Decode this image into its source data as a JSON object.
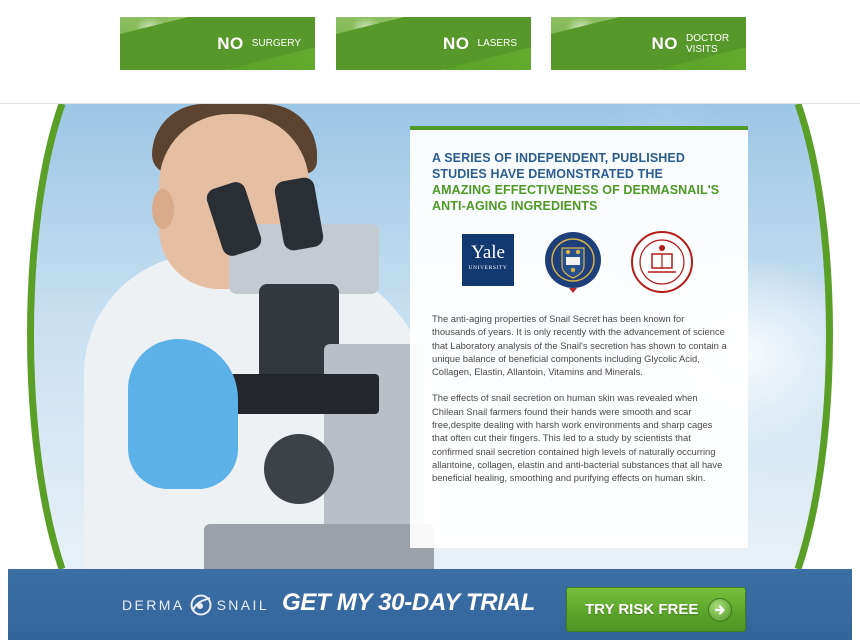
{
  "badges": [
    {
      "no": "NO",
      "word": "SURGERY"
    },
    {
      "no": "NO",
      "word": "LASERS"
    },
    {
      "no": "NO",
      "word": "DOCTOR VISITS"
    }
  ],
  "panel": {
    "heading_blue": "A SERIES OF INDEPENDENT, PUBLISHED STUDIES HAVE DEMONSTRATED THE",
    "heading_green": "AMAZING EFFECTIVENESS OF DERMASNAIL'S ANTI-AGING INGREDIENTS",
    "logos": {
      "yale_name": "Yale",
      "yale_sub": "UNIVERSITY"
    },
    "paragraphs": [
      "The anti-aging properties of Snail Secret has been known for thousands of years. It is only recently with the advancement of science that Laboratory analysis of the Snail's secretion has shown to contain a unique balance of beneficial components including Glycolic Acid, Collagen, Elastin, Allantoin, Vitamins and Minerals.",
      "The effects of snail secretion on human skin was revealed when Chilean Snail farmers found their hands were smooth and scar free,despite dealing with harsh work environments and sharp cages that often cut their fingers. This led to a study by scientists that confirmed snail secretion contained high levels of naturally occurring allantoine, collagen, elastin and anti-bacterial substances that all have beneficial healing, smoothing and purifying effects on human skin."
    ]
  },
  "cta": {
    "brand_left": "DERMA",
    "brand_right": "SNAIL",
    "headline": "GET MY 30-DAY TRIAL",
    "button_label": "TRY RISK FREE"
  },
  "colors": {
    "accent_green": "#4e9a25",
    "heading_blue": "#2c5d8f",
    "cta_blue": "#3c6fa4"
  },
  "icons": [
    "yale-logo-icon",
    "oxford-crest-icon",
    "cornell-seal-icon",
    "dermasnail-logo-icon",
    "arrow-right-circle-icon"
  ]
}
